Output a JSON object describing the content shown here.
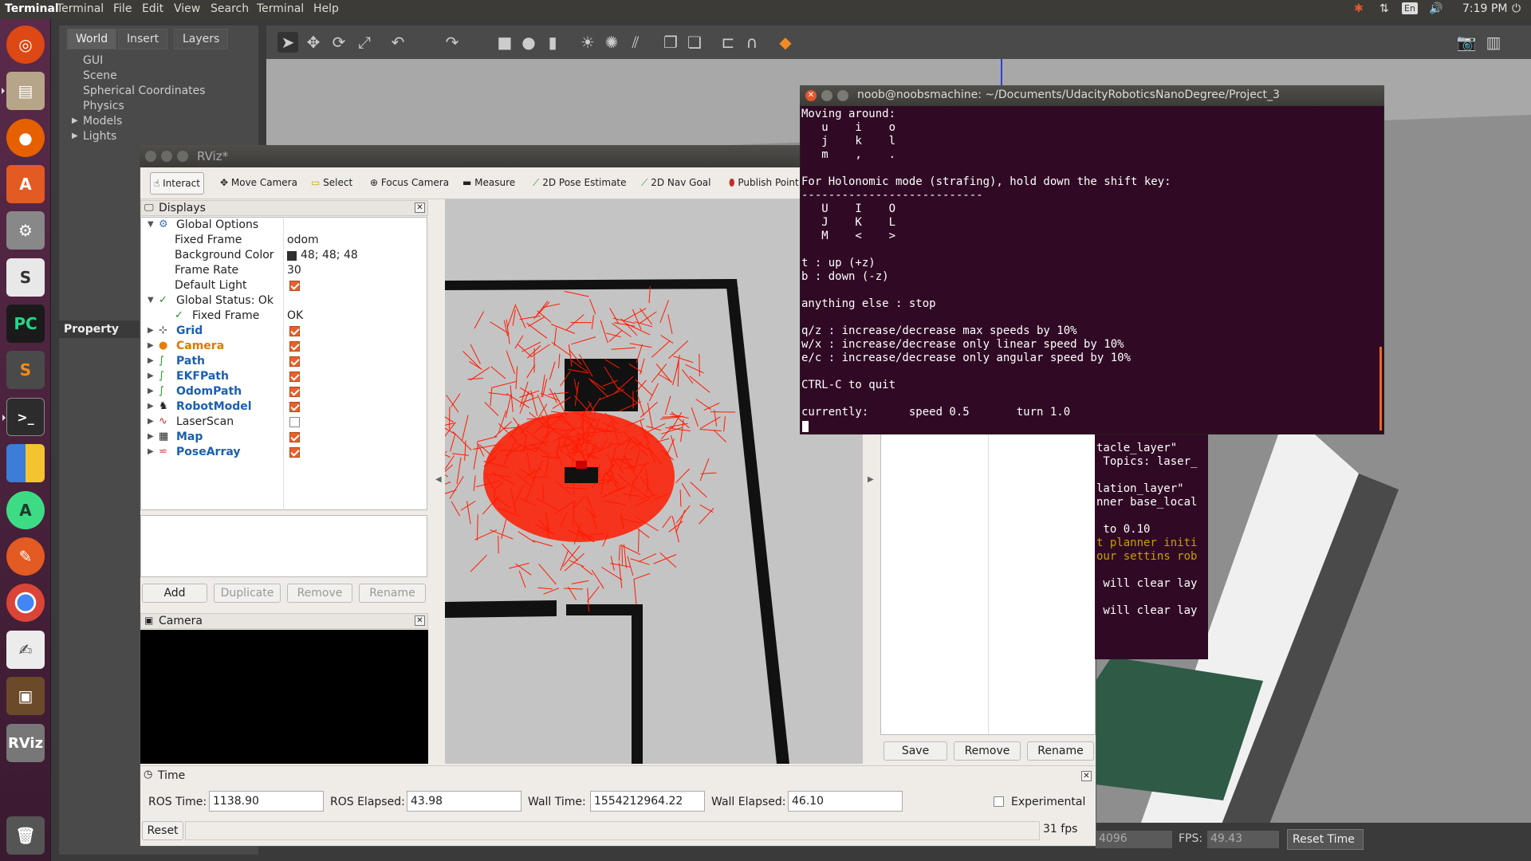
{
  "topbar": {
    "app_name": "Terminal",
    "menus": [
      "Terminal",
      "File",
      "Edit",
      "View",
      "Search",
      "Terminal",
      "Help"
    ],
    "lang": "En",
    "clock": "7:19 PM"
  },
  "launcher": {
    "apps": [
      "ubuntu-logo",
      "files",
      "firefox",
      "software-center",
      "settings",
      "sublime-s",
      "pycharm",
      "sublime-text",
      "terminal",
      "workspaces",
      "android-studio",
      "app-store",
      "chrome",
      "text-editor",
      "virtualbox",
      "rviz",
      "trash"
    ],
    "rviz_label": "RViz"
  },
  "gazebo": {
    "tabs": [
      "World",
      "Insert",
      "Layers"
    ],
    "tree": [
      "GUI",
      "Scene",
      "Spherical Coordinates",
      "Physics",
      "Models",
      "Lights"
    ],
    "property_label": "Property",
    "bottom": {
      "iterations_partial": "4096",
      "fps_label": "FPS:",
      "fps_value": "49.43",
      "reset_time": "Reset Time"
    }
  },
  "rviz": {
    "title": "RViz*",
    "tools": [
      "Interact",
      "Move Camera",
      "Select",
      "Focus Camera",
      "Measure",
      "2D Pose Estimate",
      "2D Nav Goal",
      "Publish Point"
    ],
    "displays_header": "Displays",
    "global_options": "Global Options",
    "props": [
      {
        "label": "Fixed Frame",
        "value": "odom"
      },
      {
        "label": "Background Color",
        "value": "48; 48; 48"
      },
      {
        "label": "Frame Rate",
        "value": "30"
      },
      {
        "label": "Default Light",
        "value": ""
      }
    ],
    "global_status": "Global Status: Ok",
    "fixed_frame_status": {
      "label": "Fixed Frame",
      "value": "OK"
    },
    "displays": [
      {
        "name": "Grid",
        "checked": true
      },
      {
        "name": "Camera",
        "checked": true
      },
      {
        "name": "Path",
        "checked": true
      },
      {
        "name": "EKFPath",
        "checked": true
      },
      {
        "name": "OdomPath",
        "checked": true
      },
      {
        "name": "RobotModel",
        "checked": true
      },
      {
        "name": "LaserScan",
        "checked": false
      },
      {
        "name": "Map",
        "checked": true
      },
      {
        "name": "PoseArray",
        "checked": true
      }
    ],
    "buttons": {
      "add": "Add",
      "duplicate": "Duplicate",
      "remove": "Remove",
      "rename": "Rename"
    },
    "camera_header": "Camera",
    "views_buttons": {
      "save": "Save",
      "remove": "Remove",
      "rename": "Rename"
    },
    "time": {
      "header": "Time",
      "ros_time_label": "ROS Time:",
      "ros_time": "1138.90",
      "ros_elapsed_label": "ROS Elapsed:",
      "ros_elapsed": "43.98",
      "wall_time_label": "Wall Time:",
      "wall_time": "1554212964.22",
      "wall_elapsed_label": "Wall Elapsed:",
      "wall_elapsed": "46.10",
      "experimental": "Experimental",
      "reset": "Reset",
      "fps": "31 fps"
    }
  },
  "terminal": {
    "title": "noob@noobsmachine: ~/Documents/UdacityRoboticsNanoDegree/Project_3",
    "lines": [
      "Moving around:",
      "   u    i    o",
      "   j    k    l",
      "   m    ,    .",
      "",
      "For Holonomic mode (strafing), hold down the shift key:",
      "---------------------------",
      "   U    I    O",
      "   J    K    L",
      "   M    <    >",
      "",
      "t : up (+z)",
      "b : down (-z)",
      "",
      "anything else : stop",
      "",
      "q/z : increase/decrease max speeds by 10%",
      "w/x : increase/decrease only linear speed by 10%",
      "e/c : increase/decrease only angular speed by 10%",
      "",
      "CTRL-C to quit",
      "",
      "currently:      speed 0.5       turn 1.0"
    ]
  },
  "bg_terminal": {
    "lines": [
      {
        "text": "tacle_layer\"",
        "yellow": false
      },
      {
        "text": " Topics: laser_",
        "yellow": false
      },
      {
        "text": "",
        "yellow": false
      },
      {
        "text": "lation_layer\"",
        "yellow": false
      },
      {
        "text": "nner base_local",
        "yellow": false
      },
      {
        "text": "",
        "yellow": false
      },
      {
        "text": " to 0.10",
        "yellow": false
      },
      {
        "text": "t planner initi",
        "yellow": true
      },
      {
        "text": "our settins rob",
        "yellow": true
      },
      {
        "text": "",
        "yellow": false
      },
      {
        "text": " will clear lay",
        "yellow": false
      },
      {
        "text": "",
        "yellow": false
      },
      {
        "text": " will clear lay",
        "yellow": false
      }
    ]
  }
}
